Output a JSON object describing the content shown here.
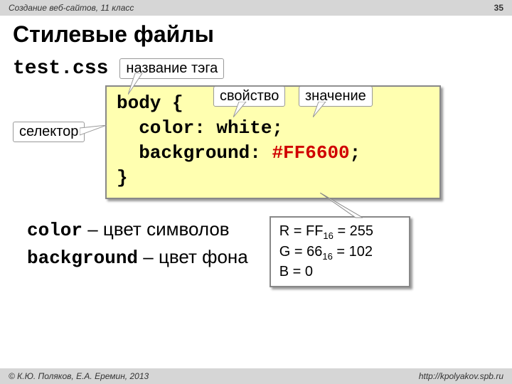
{
  "header": {
    "left": "Создание веб-сайтов, 11 класс",
    "page": "35"
  },
  "title": "Стилевые файлы",
  "filename": "test.css",
  "labels": {
    "tagname": "название тэга",
    "selector": "селектор",
    "property": "свойство",
    "value": "значение"
  },
  "code": {
    "l1a": "body {",
    "l2": "  color: white;",
    "l3a": "  background: ",
    "l3b": "#FF6600",
    "l3c": ";",
    "l4": "}"
  },
  "defs": {
    "color_kw": "color",
    "color_desc": " – цвет символов",
    "bg_kw": "background",
    "bg_desc": " – цвет фона"
  },
  "rgb": {
    "r_label": "R = FF",
    "r_sub": "16",
    "r_val": " = 255",
    "g_label": "G = 66",
    "g_sub": "16",
    "g_val": " = 102",
    "b_label": "B = 0"
  },
  "footer": {
    "left": "© К.Ю. Поляков, Е.А. Еремин, 2013",
    "right": "http://kpolyakov.spb.ru"
  }
}
